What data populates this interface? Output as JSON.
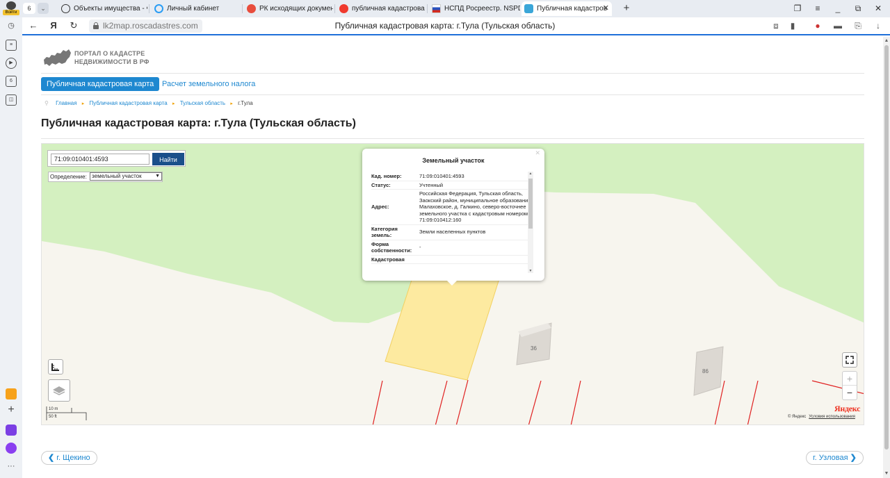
{
  "browser": {
    "profile_label": "Войти",
    "tab_count": "6",
    "tabs": [
      {
        "title": "Объекты имущества - Ф"
      },
      {
        "title": "Личный кабинет"
      },
      {
        "title": "РК исходящих докумен"
      },
      {
        "title": "публичная кадастрова"
      },
      {
        "title": "НСПД Росреестр. NSPD"
      },
      {
        "title": "Публичная кадастров"
      }
    ],
    "url": "lk2map.roscadastres.com",
    "page_title": "Публичная кадастровая карта: г.Тула (Тульская область)"
  },
  "site": {
    "logo_line1": "ПОРТАЛ О КАДАСТРЕ",
    "logo_line2": "НЕДВИЖИМОСТИ В РФ",
    "nav": {
      "primary": "Публичная кадастровая карта",
      "secondary": "Расчет земельного налога"
    },
    "breadcrumbs": [
      "Главная",
      "Публичная кадастровая карта",
      "Тульская область",
      "г.Тула"
    ],
    "heading": "Публичная кадастровая карта: г.Тула (Тульская область)"
  },
  "map": {
    "search_value": "71:09:010401:4593",
    "search_button": "Найти",
    "definition_label": "Определение:",
    "definition_value": "земельный участок",
    "popup": {
      "title": "Земельный участок",
      "rows": [
        {
          "key": "Кад. номер:",
          "value": "71:09:010401:4593"
        },
        {
          "key": "Статус:",
          "value": "Учтенный"
        },
        {
          "key": "Адрес:",
          "value": "Российская Федерация, Тульская область, Заокский район, муниципальное образование Малаховское, д. Галкино, северо-восточнее земельного участка с кадастровым номером 71:09:010412:160"
        },
        {
          "key": "Категория земель:",
          "value": "Земли населенных пунктов"
        },
        {
          "key": "Форма собственности:",
          "value": "-"
        },
        {
          "key": "Кадастровая",
          "value": ""
        }
      ]
    },
    "houses": [
      "36",
      "86"
    ],
    "scale_m": "10 m",
    "scale_ft": "50 ft",
    "yandex_logo": "Яндекс",
    "copyright": "© Яндекс",
    "terms": "Условия использования",
    "colors": {
      "green": "#d4f0c0",
      "parcel": "#fdeaa0",
      "parcel_stroke": "#f2d060",
      "land": "#f7f5ee",
      "boundary": "#e02020"
    }
  },
  "pager": {
    "prev": "г. Щекино",
    "next": "г. Узловая"
  }
}
